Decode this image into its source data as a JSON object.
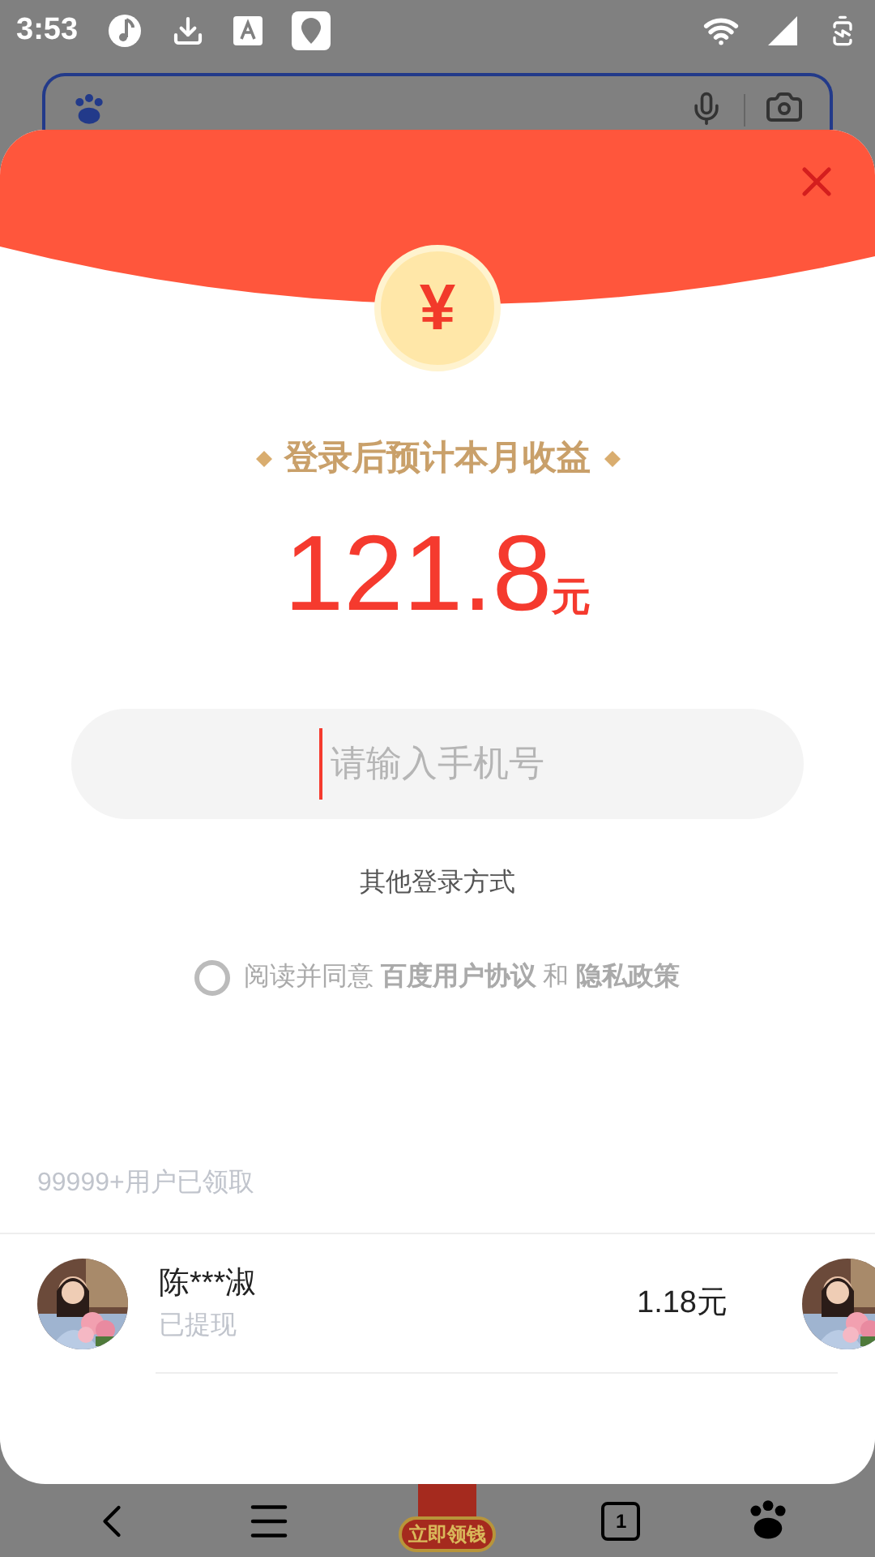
{
  "status_bar": {
    "time": "3:53"
  },
  "dialog": {
    "coin_symbol": "¥",
    "title": "登录后预计本月收益",
    "amount": "121.8",
    "unit": "元",
    "phone_field": {
      "placeholder": "请输入手机号"
    },
    "other_login": "其他登录方式",
    "agreement": {
      "checked": false,
      "text": "阅读并同意 **百度用户协议** 和 **隐私政策**"
    },
    "claimed_count": "99999+用户已领取",
    "records": [
      {
        "name": "陈***淑",
        "status": "已提现",
        "amount": "1.18元"
      }
    ]
  },
  "bottom_nav": {
    "promo_label": "立即领钱",
    "tab_count": "1"
  }
}
